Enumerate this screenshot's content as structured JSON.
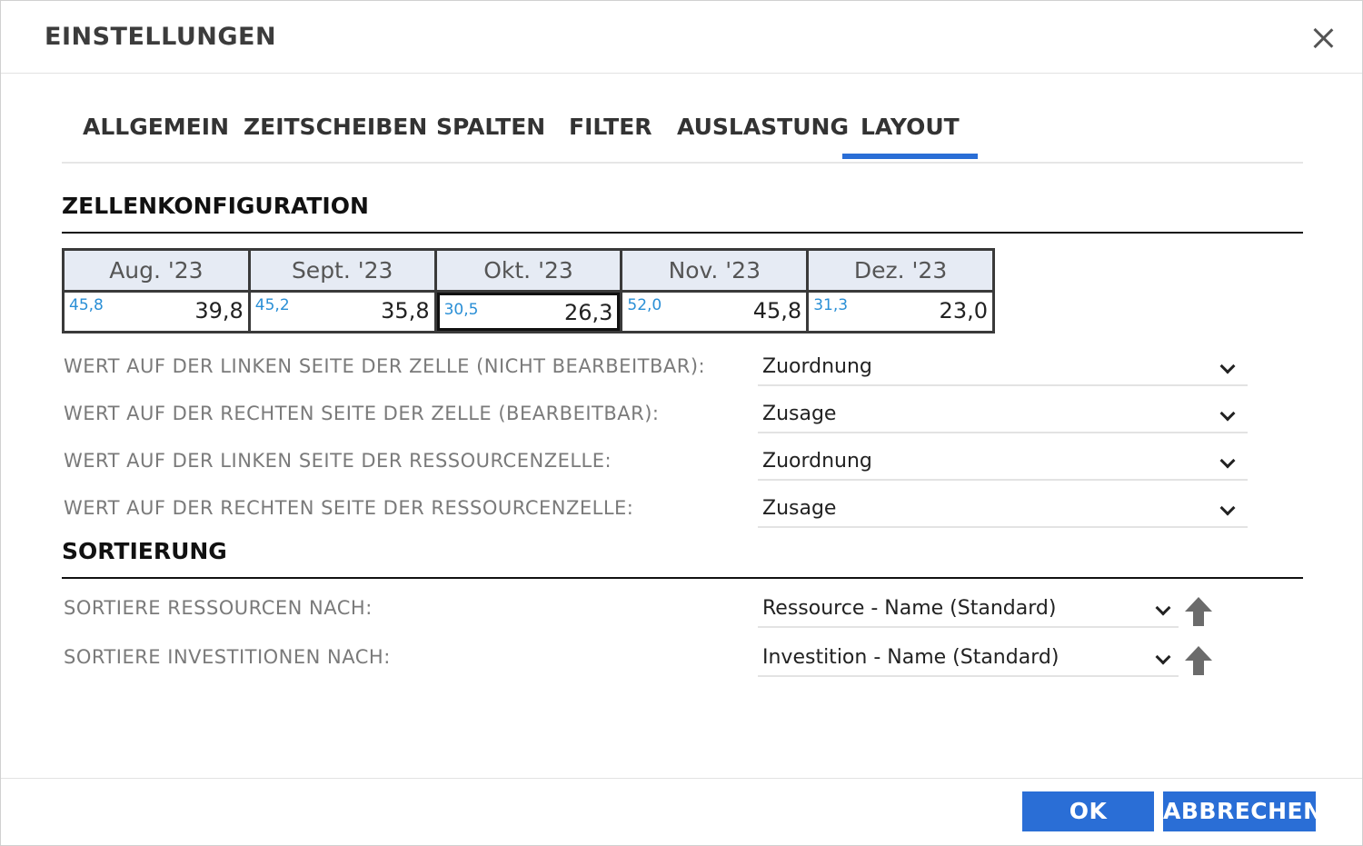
{
  "dialog": {
    "title": "EINSTELLUNGEN",
    "close_icon": "close-icon"
  },
  "tabs": [
    {
      "label": "ALLGEMEIN"
    },
    {
      "label": "ZEITSCHEIBEN"
    },
    {
      "label": "SPALTEN"
    },
    {
      "label": "FILTER"
    },
    {
      "label": "AUSLASTUNG"
    },
    {
      "label": "LAYOUT",
      "active": true
    }
  ],
  "cell_config": {
    "title": "ZELLENKONFIGURATION",
    "preview": {
      "columns": [
        {
          "header": "Aug. '23",
          "left": "45,8",
          "right": "39,8"
        },
        {
          "header": "Sept. '23",
          "left": "45,2",
          "right": "35,8"
        },
        {
          "header": "Okt. '23",
          "left": "30,5",
          "right": "26,3",
          "selected": true
        },
        {
          "header": "Nov. '23",
          "left": "52,0",
          "right": "45,8"
        },
        {
          "header": "Dez. '23",
          "left": "31,3",
          "right": "23,0"
        }
      ]
    },
    "rows": [
      {
        "label": "WERT AUF DER LINKEN SEITE DER ZELLE (NICHT BEARBEITBAR):",
        "value": "Zuordnung"
      },
      {
        "label": "WERT AUF DER RECHTEN SEITE DER ZELLE (BEARBEITBAR):",
        "value": "Zusage"
      },
      {
        "label": "WERT AUF DER LINKEN SEITE DER RESSOURCENZELLE:",
        "value": "Zuordnung"
      },
      {
        "label": "WERT AUF DER RECHTEN SEITE DER RESSOURCENZELLE:",
        "value": "Zusage"
      }
    ]
  },
  "sorting": {
    "title": "SORTIERUNG",
    "rows": [
      {
        "label": "SORTIERE RESSOURCEN NACH:",
        "value": "Ressource - Name (Standard)",
        "direction": "ascending"
      },
      {
        "label": "SORTIERE INVESTITIONEN NACH:",
        "value": "Investition - Name (Standard)",
        "direction": "ascending"
      }
    ]
  },
  "footer": {
    "ok_label": "OK",
    "cancel_label": "ABBRECHEN"
  },
  "colors": {
    "accent": "#2a6ed6",
    "left_value": "#2a8fd6",
    "preview_header_bg": "#e6ebf4"
  }
}
